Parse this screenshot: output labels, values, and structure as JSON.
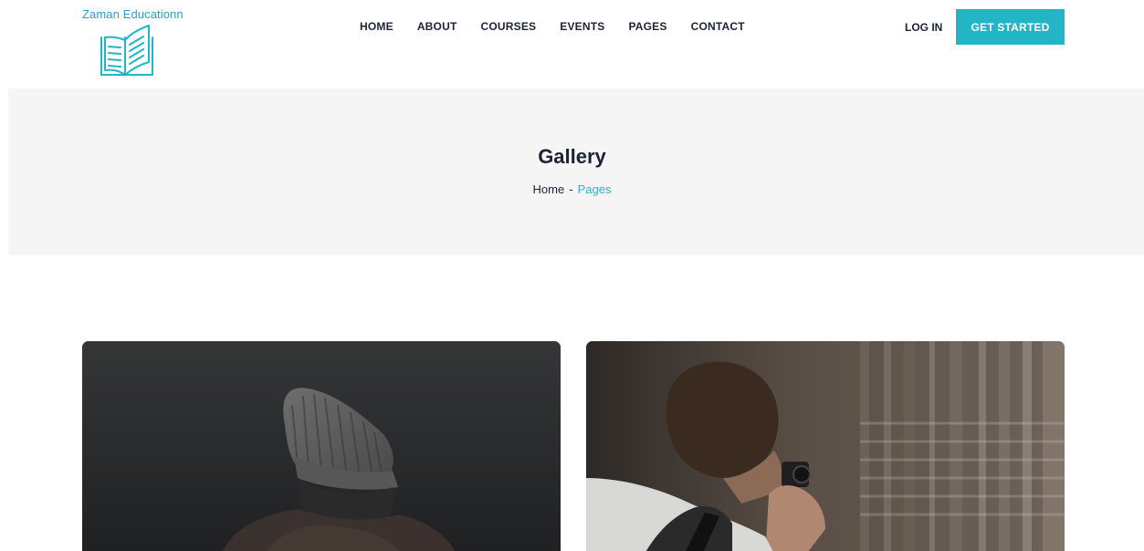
{
  "brand": {
    "name": "Zaman Educationn",
    "accent": "#21b5c5",
    "icon": "open-book-icon"
  },
  "nav": {
    "items": [
      {
        "label": "HOME"
      },
      {
        "label": "ABOUT"
      },
      {
        "label": "COURSES"
      },
      {
        "label": "EVENTS"
      },
      {
        "label": "PAGES"
      },
      {
        "label": "CONTACT"
      }
    ]
  },
  "auth": {
    "login_label": "LOG IN",
    "cta_label": "GET STARTED"
  },
  "banner": {
    "title": "Gallery",
    "breadcrumb": {
      "home": "Home",
      "separator": "-",
      "current": "Pages"
    }
  },
  "gallery": {
    "images": [
      {
        "subject": "person-in-knit-beanie-photo"
      },
      {
        "subject": "photographer-with-camera-photo"
      }
    ]
  }
}
